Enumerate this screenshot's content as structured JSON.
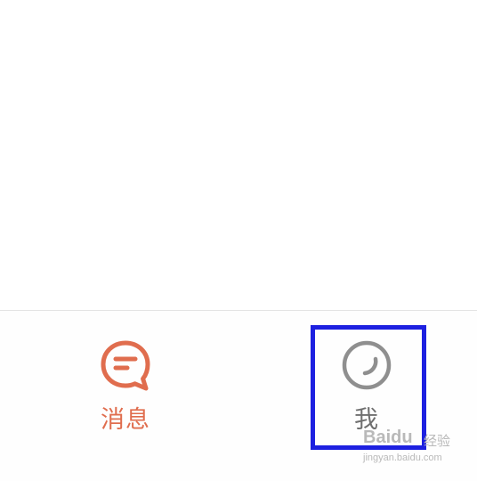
{
  "tabs": [
    {
      "id": "messages",
      "label": "消息",
      "icon": "chat-bubble-icon",
      "active": true
    },
    {
      "id": "me",
      "label": "我",
      "icon": "profile-circle-icon",
      "active": false
    }
  ],
  "colors": {
    "active": "#e06d4e",
    "inactive": "#6f6f6f",
    "highlight": "#1d20e0"
  },
  "watermark": {
    "logo": "Baidu",
    "text": "经验",
    "url": "jingyan.baidu.com"
  }
}
